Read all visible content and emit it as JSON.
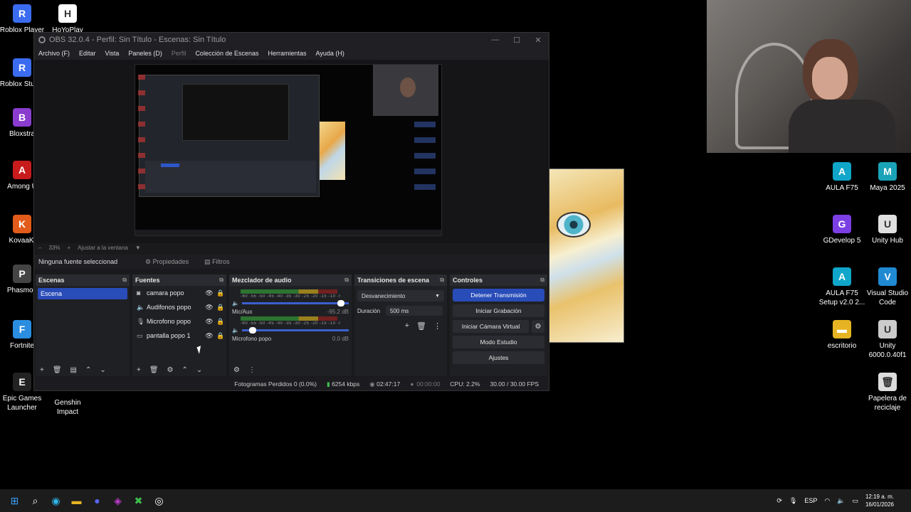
{
  "desktop_left": [
    {
      "label": "Roblox Player",
      "color": "#3b6cf0",
      "glyph": "R"
    },
    {
      "label": "HoYoPlay",
      "color": "#ffffff",
      "glyph": "H"
    },
    {
      "label": "Roblox Studio",
      "color": "#3b6cf0",
      "glyph": "R"
    },
    {
      "label": "Bloxstra",
      "color": "#8a3ccf",
      "glyph": "B"
    },
    {
      "label": "Among U",
      "color": "#c81b1b",
      "glyph": "A"
    },
    {
      "label": "KovaaK'",
      "color": "#e35b1a",
      "glyph": "K"
    },
    {
      "label": "Phasmop",
      "color": "#444444",
      "glyph": "P"
    },
    {
      "label": "Fortnite",
      "color": "#2a8de0",
      "glyph": "F"
    },
    {
      "label": "Epic Games Launcher",
      "color": "#222222",
      "glyph": "E"
    },
    {
      "label": "Genshin Impact",
      "color": "#000000",
      "glyph": ""
    }
  ],
  "desktop_right": [
    {
      "label": "AULA F75",
      "color": "#0fa6c9",
      "glyph": "A"
    },
    {
      "label": "Maya 2025",
      "color": "#1aa3b8",
      "glyph": "M"
    },
    {
      "label": "GDevelop 5",
      "color": "#7b3fe4",
      "glyph": "G"
    },
    {
      "label": "Unity Hub",
      "color": "#e0e0e0",
      "glyph": "U"
    },
    {
      "label": "AULA F75 Setup v2.0 2...",
      "color": "#0fa6c9",
      "glyph": "A"
    },
    {
      "label": "Visual Studio Code",
      "color": "#1f8ad2",
      "glyph": "V"
    },
    {
      "label": "escritorio",
      "color": "#e6b422",
      "glyph": "▬"
    },
    {
      "label": "Unity 6000.0.40f1",
      "color": "#cccccc",
      "glyph": "U"
    },
    {
      "label": "Papelera de reciclaje",
      "color": "#dddddd",
      "glyph": "🗑"
    }
  ],
  "obs": {
    "title": "OBS 32.0.4 - Perfil: Sin Título - Escenas: Sin Título",
    "menu": [
      "Archivo (F)",
      "Editar",
      "Vista",
      "Paneles (D)",
      "Perfil",
      "Colección de Escenas",
      "Herramientas",
      "Ayuda (H)"
    ],
    "zoom": "33%",
    "fit_label": "Ajustar a la ventana",
    "no_source": "Ninguna fuente seleccionad",
    "properties": "Propiedades",
    "filters": "Filtros",
    "docks": {
      "scenes": {
        "title": "Escenas",
        "items": [
          "Escena"
        ]
      },
      "sources": {
        "title": "Fuentes",
        "items": [
          {
            "icon": "camera-icon",
            "glyph": "◙",
            "name": "camara popo"
          },
          {
            "icon": "speaker-icon",
            "glyph": "🔈",
            "name": "Audifonos popo"
          },
          {
            "icon": "microphone-icon",
            "glyph": "🎙",
            "name": "Microfono popo"
          },
          {
            "icon": "monitor-icon",
            "glyph": "▭",
            "name": "pantalla popo 1"
          }
        ]
      },
      "mixer": {
        "title": "Mezclador de audio",
        "scale": "-60 -55 -50 -45 -40 -35 -30 -25 -20 -15 -10 -5 0",
        "channels": [
          {
            "name": "",
            "db": "",
            "level": 0.93
          },
          {
            "name": "Mic/Aux",
            "db": "-95.2 dB",
            "level": 0.1
          },
          {
            "name": "Microfono popo",
            "db": "0.0 dB",
            "level": 0.5
          }
        ]
      },
      "transitions": {
        "title": "Transiciones de escena",
        "selected": "Desvanecimiento",
        "duration_label": "Duración",
        "duration_value": "500 ms"
      },
      "controls": {
        "title": "Controles",
        "stop_stream": "Detener Transmisión",
        "start_record": "Iniciar Grabación",
        "virtual_cam": "Iniciar Cámara Virtual",
        "studio": "Modo Estudio",
        "settings": "Ajustes"
      }
    },
    "status": {
      "dropped": "Fotogramas Perdidos 0 (0.0%)",
      "bitrate": "6254 kbps",
      "stream_time": "02:47:17",
      "rec_time": "00:00:00",
      "cpu": "CPU: 2.2%",
      "fps": "30.00 / 30.00 FPS"
    }
  },
  "taskbar": {
    "lang": "ESP",
    "time": "12:19 a. m.",
    "date": "16/01/2026"
  }
}
